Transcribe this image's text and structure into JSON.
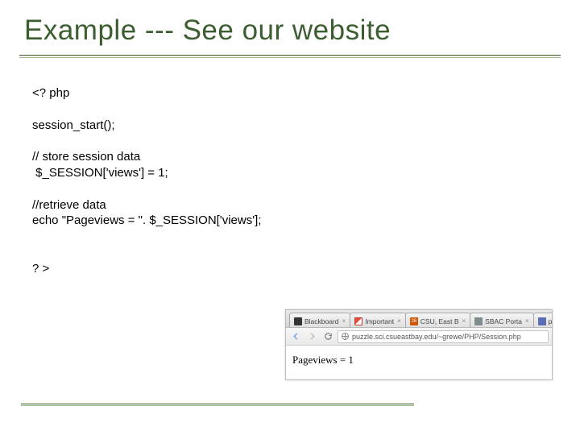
{
  "title": "Example --- See our website",
  "code": "<? php\n\nsession_start();\n\n// store session data\n $_SESSION['views'] = 1;\n\n//retrieve data\necho \"Pageviews = \". $_SESSION['views'];\n\n\n? >",
  "browser": {
    "tabs": [
      {
        "label": "Blackboard"
      },
      {
        "label": "Important"
      },
      {
        "label": "CSU, East B"
      },
      {
        "label": "SBAC Porta"
      },
      {
        "label": "pu"
      }
    ],
    "url": "puzzle.sci.csueastbay.edu/~grewe/PHP/Session.php",
    "output": "Pageviews = 1"
  }
}
